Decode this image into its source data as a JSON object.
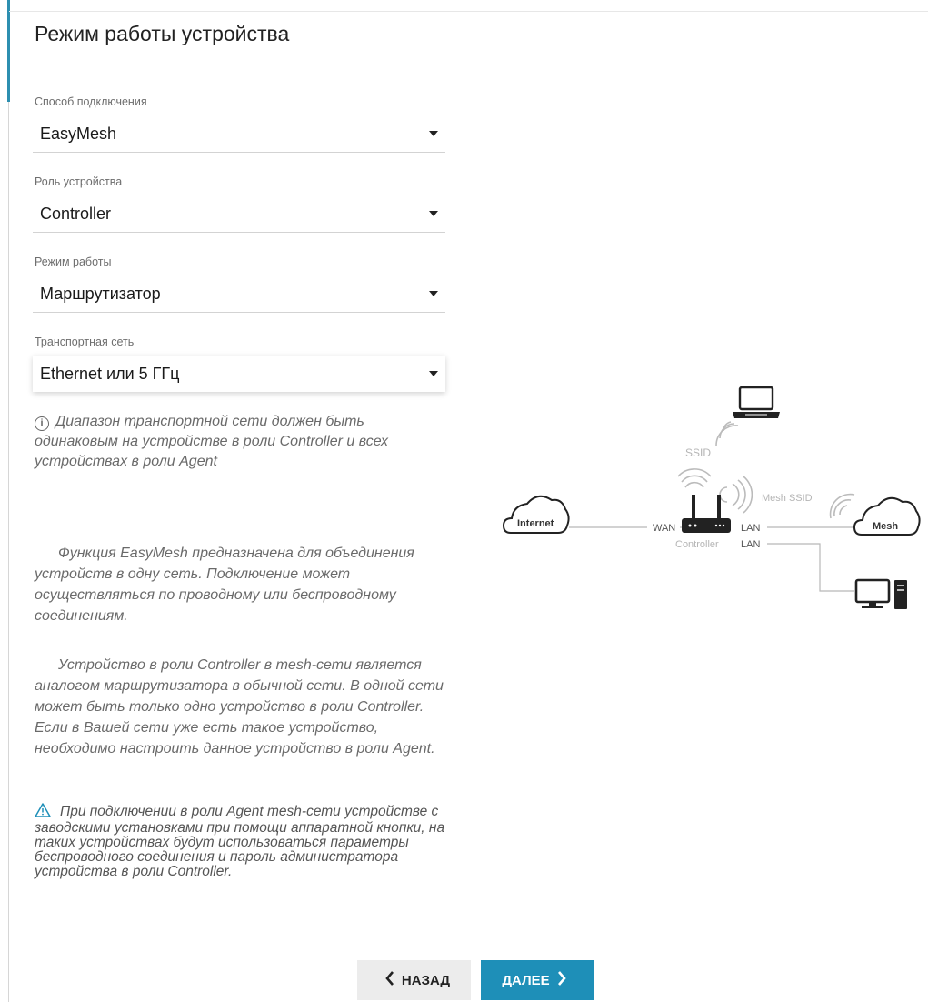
{
  "page": {
    "title": "Режим работы устройства"
  },
  "fields": {
    "connection": {
      "label": "Способ подключения",
      "value": "EasyMesh"
    },
    "role": {
      "label": "Роль устройства",
      "value": "Controller"
    },
    "mode": {
      "label": "Режим работы",
      "value": "Маршрутизатор"
    },
    "backhaul": {
      "label": "Транспортная сеть",
      "value": "Ethernet или 5 ГГц"
    }
  },
  "note": {
    "text": "Диапазон транспортной сети должен быть одинаковым на устройстве в роли Controller и всех устройствах в роли Agent"
  },
  "description": {
    "paragraph1": "Функция EasyMesh предназначена для объединения устройств в одну сеть. Подключение может осуществляться по проводному или беспроводному соединениям.",
    "paragraph2": "Устройство в роли Controller в mesh-сети является аналогом маршрутизатора в обычной сети. В одной сети может быть только одно устройство в роли Controller. Если в Вашей сети уже есть такое устройство, необходимо настроить данное устройство в роли Agent."
  },
  "warning": {
    "text": "При подключении в роли Agent mesh-сети устройстве с заводскими установками при помощи аппаратной кнопки, на таких устройствах будут использоваться параметры беспроводного соединения и пароль администратора устройства в роли Controller."
  },
  "diagram": {
    "internet": "Internet",
    "ssid": "SSID",
    "mesh_ssid": "Mesh SSID",
    "mesh": "Mesh",
    "wan": "WAN",
    "lan1": "LAN",
    "lan2": "LAN",
    "controller": "Controller"
  },
  "buttons": {
    "back": "НАЗАД",
    "next": "ДАЛЕЕ"
  },
  "colors": {
    "accent": "#1e8fb8",
    "back_button": "#ececec"
  }
}
